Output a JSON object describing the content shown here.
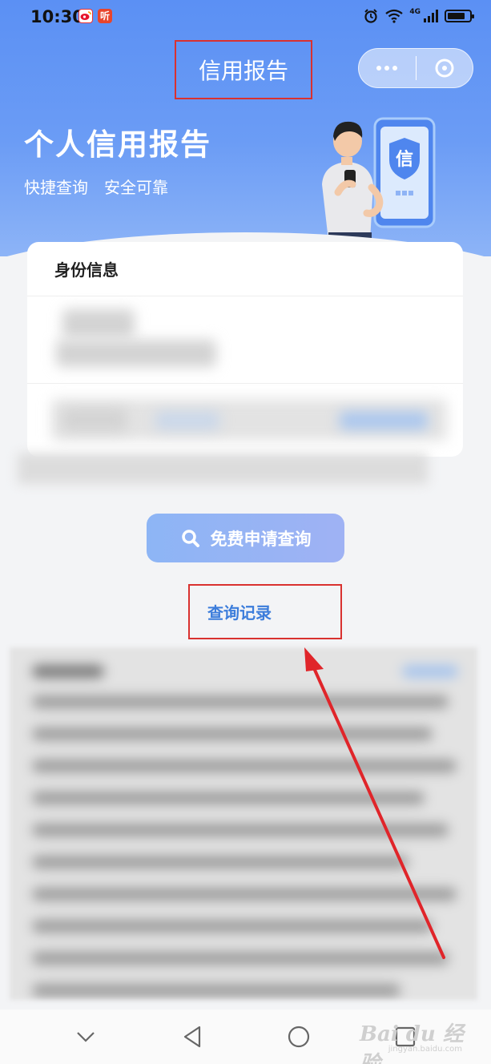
{
  "status_bar": {
    "time": "10:30",
    "network": "4G",
    "app_badge": "听"
  },
  "header": {
    "title": "信用报告",
    "more_icon": "more-dots-icon",
    "close_icon": "close-circle-icon"
  },
  "hero": {
    "title": "个人信用报告",
    "tags": [
      "快捷查询",
      "安全可靠"
    ],
    "shield_text": "信"
  },
  "identity_card": {
    "section_title": "身份信息"
  },
  "actions": {
    "apply_label": "免费申请查询",
    "records_label": "查询记录"
  },
  "watermark": {
    "brand": "Bai du 经验",
    "url": "jingyan.baidu.com"
  },
  "colors": {
    "hero": "#5b90f4",
    "accent": "#3c7ddb",
    "highlight_box": "#d9312f",
    "arrow": "#e0252a"
  }
}
